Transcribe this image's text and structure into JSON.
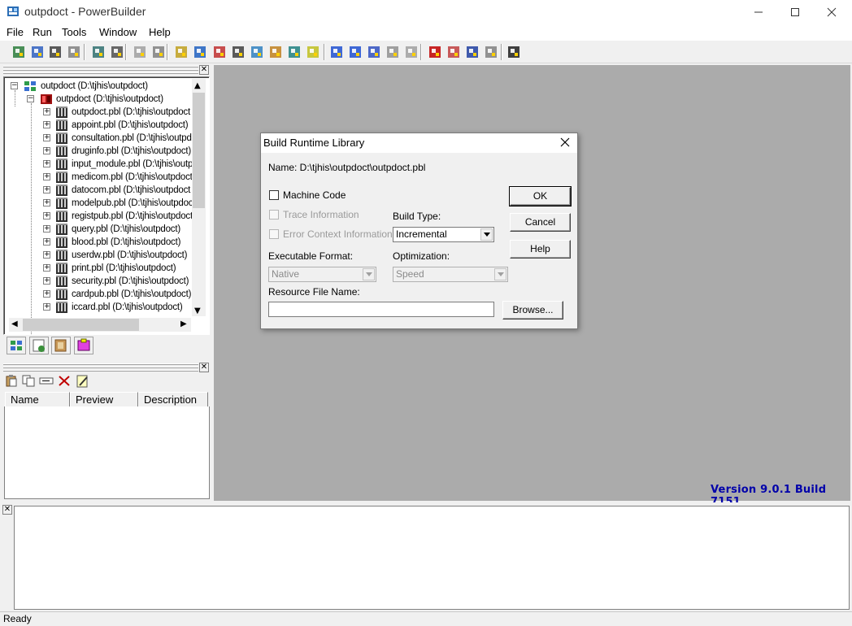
{
  "window": {
    "title": "outpdoct - PowerBuilder"
  },
  "menu": [
    "File",
    "Run",
    "Tools",
    "Window",
    "Help"
  ],
  "toolbar": {
    "icons": [
      "new-icon",
      "inherit-icon",
      "open-icon",
      "browser-icon",
      "layout-icon-1",
      "layout-icon-2",
      "import-icon",
      "export-icon",
      "library-icon",
      "script-icon",
      "debug-icon",
      "database-icon",
      "pipeline-icon",
      "query-icon",
      "table-icon",
      "edit-icon",
      "build-icon",
      "deploy-icon",
      "migrate-icon",
      "regen-icon",
      "rebuild-icon",
      "stop-icon",
      "run-icon",
      "runner-icon",
      "tools-icon",
      "exit-icon"
    ]
  },
  "tree": {
    "workspace": "outpdoct (D:\\tjhis\\outpdoct)",
    "target": "outpdoct (D:\\tjhis\\outpdoct)",
    "libraries": [
      "outpdoct.pbl (D:\\tjhis\\outpdoct",
      "appoint.pbl (D:\\tjhis\\outpdoct)",
      "consultation.pbl (D:\\tjhis\\outpd",
      "druginfo.pbl (D:\\tjhis\\outpdoct)",
      "input_module.pbl (D:\\tjhis\\outp",
      "medicom.pbl (D:\\tjhis\\outpdoct",
      "datocom.pbl (D:\\tjhis\\outpdoct",
      "modelpub.pbl (D:\\tjhis\\outpdoc",
      "registpub.pbl (D:\\tjhis\\outpdoct",
      "query.pbl (D:\\tjhis\\outpdoct)",
      "blood.pbl (D:\\tjhis\\outpdoct)",
      "userdw.pbl (D:\\tjhis\\outpdoct)",
      "print.pbl (D:\\tjhis\\outpdoct)",
      "security.pbl (D:\\tjhis\\outpdoct)",
      "cardpub.pbl (D:\\tjhis\\outpdoct)",
      "iccard.pbl (D:\\tjhis\\outpdoct)"
    ]
  },
  "list": {
    "columns": [
      "Name",
      "Preview",
      "Description"
    ]
  },
  "version": "Version 9.0.1 Build 7151",
  "status": "Ready",
  "dialog": {
    "title": "Build Runtime Library",
    "name_line": "Name:  D:\\tjhis\\outpdoct\\outpdoct.pbl",
    "machine_code": "Machine Code",
    "trace_info": "Trace Information",
    "error_context": "Error Context Information",
    "build_type_label": "Build Type:",
    "build_type_value": "Incremental",
    "exec_format_label": "Executable Format:",
    "exec_format_value": "Native",
    "optimization_label": "Optimization:",
    "optimization_value": "Speed",
    "resource_label": "Resource File Name:",
    "resource_value": "",
    "ok": "OK",
    "cancel": "Cancel",
    "help": "Help",
    "browse": "Browse..."
  }
}
